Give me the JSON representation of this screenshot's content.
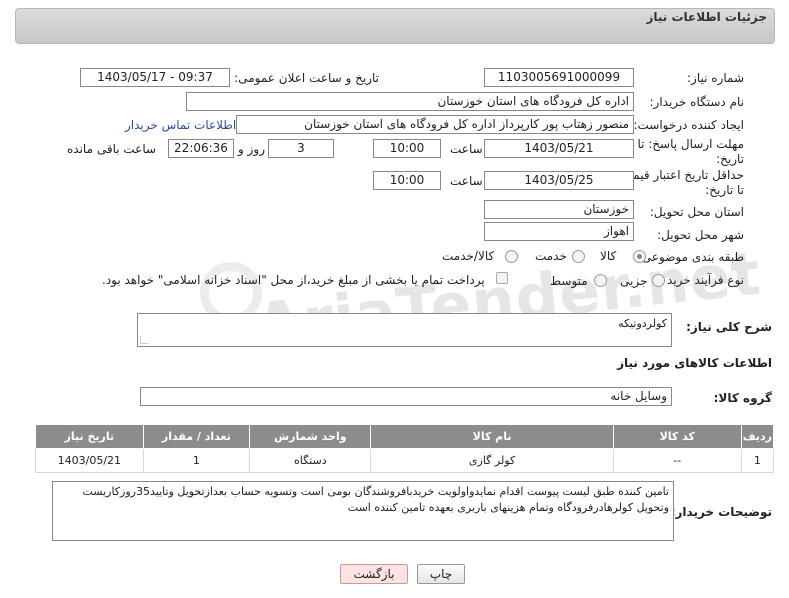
{
  "header": {
    "title": "جزئیات اطلاعات نیاز"
  },
  "watermark": {
    "text": "AriaTender.net"
  },
  "fields": {
    "need_number_label": "شماره نیاز:",
    "need_number": "1103005691000099",
    "announce_label": "تاریخ و ساعت اعلان عمومی:",
    "announce_value": "1403/05/17 - 09:37",
    "buyer_org_label": "نام دستگاه خریدار:",
    "buyer_org": "اداره کل فرودگاه های استان خوزستان",
    "creator_label": "ایجاد کننده درخواست:",
    "creator": "منصور زهتاب پور کارپرداز اداره کل فرودگاه های استان خوزستان",
    "contact_link": "اطلاعات تماس خریدار",
    "reply_deadline_label": "مهلت ارسال پاسخ: تا تاریخ:",
    "reply_date": "1403/05/21",
    "time_label": "ساعت",
    "reply_time": "10:00",
    "days_value": "3",
    "days_and_label": "روز و",
    "remaining_time": "22:06:36",
    "remaining_label": "ساعت باقی مانده",
    "price_validity_label": "حداقل تاریخ اعتبار قیمت: تا تاریخ:",
    "price_date": "1403/05/25",
    "price_time": "10:00",
    "province_label": "استان محل تحویل:",
    "province": "خوزستان",
    "city_label": "شهر محل تحویل:",
    "city": "اهواز",
    "category_label": "طبقه بندی موضوعی:",
    "category_options": [
      "کالا",
      "خدمت",
      "کالا/خدمت"
    ],
    "purchase_type_label": "نوع فرآیند خرید :",
    "purchase_options": [
      "جزیی",
      "متوسط"
    ],
    "payment_note": "پرداخت تمام یا بخشی از مبلغ خرید،از محل \"اسناد خزانه اسلامی\" خواهد بود."
  },
  "summary": {
    "label": "شرح کلی نیاز:",
    "value": "کولردوتیکه"
  },
  "goods_info_title": "اطلاعات کالاهای مورد نیاز",
  "goods_group": {
    "label": "گروه کالا:",
    "value": "وسایل خانه"
  },
  "table": {
    "headers": [
      "ردیف",
      "کد کالا",
      "نام کالا",
      "واحد شمارش",
      "تعداد / مقدار",
      "تاریخ نیاز"
    ],
    "rows": [
      [
        "1",
        "--",
        "کولر گازی",
        "دستگاه",
        "1",
        "1403/05/21"
      ]
    ]
  },
  "buyer_notes": {
    "label": "توضیحات خریدار:",
    "value": "تامین کننده طبق لیست پیوست اقدام نمایدواولویت خریدبافروشندگان بومی است وتسویه حساب بعدازتحویل وتایید35روزکاریست وتحویل کولرهادرفرودگاه وتمام هزینهای باربری بعهده تامین کننده است"
  },
  "buttons": {
    "print": "چاپ",
    "back": "بازگشت"
  }
}
